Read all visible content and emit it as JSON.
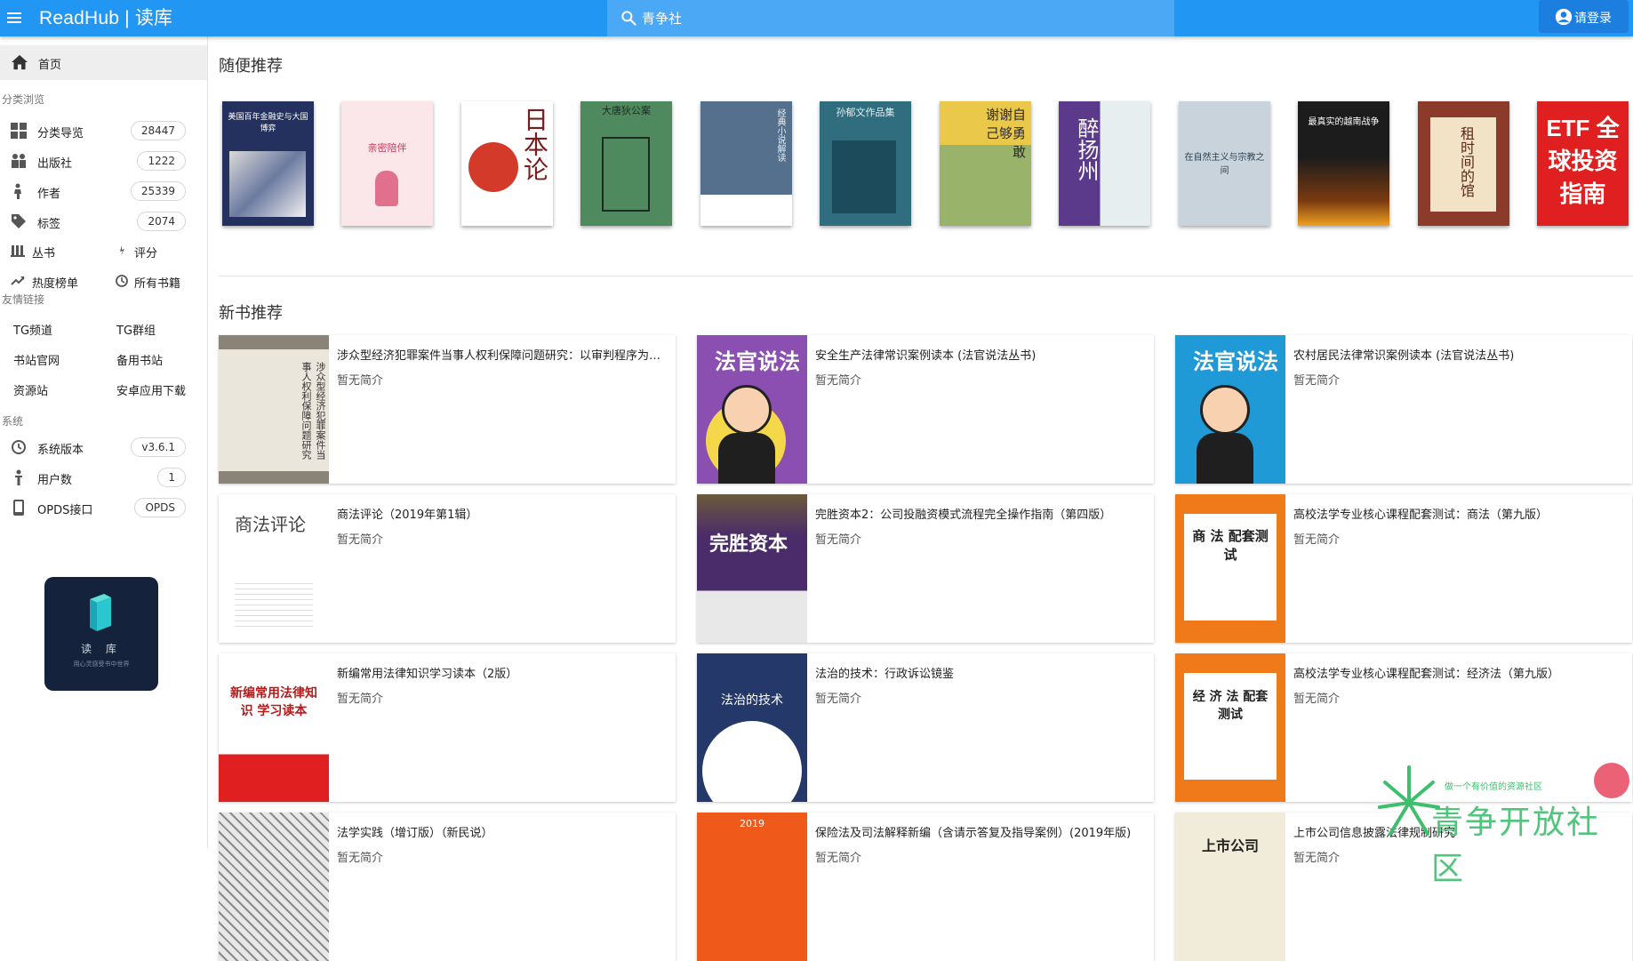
{
  "header": {
    "brand": "ReadHub | 读库",
    "search_value": "青争社",
    "login_label": "请登录"
  },
  "sidebar": {
    "home": "首页",
    "section_browse": "分类浏览",
    "browse_items": [
      {
        "label": "分类导览",
        "count": "28447",
        "icon": "grid-icon"
      },
      {
        "label": "出版社",
        "count": "1222",
        "icon": "publisher-icon"
      },
      {
        "label": "作者",
        "count": "25339",
        "icon": "person-icon"
      },
      {
        "label": "标签",
        "count": "2074",
        "icon": "tag-icon"
      }
    ],
    "series": "丛书",
    "rating": "评分",
    "hot": "热度榜单",
    "all_books": "所有书籍",
    "section_links": "友情链接",
    "links": [
      "TG频道",
      "TG群组",
      "书站官网",
      "备用书站",
      "资源站",
      "安卓应用下载"
    ],
    "section_system": "系统",
    "system_items": [
      {
        "label": "系统版本",
        "count": "v3.6.1",
        "icon": "history-icon"
      },
      {
        "label": "用户数",
        "count": "1",
        "icon": "user-icon"
      },
      {
        "label": "OPDS接口",
        "count": "OPDS",
        "icon": "phone-icon"
      }
    ],
    "app_name": "读 库",
    "app_slogan": "用心灵感受书中世界"
  },
  "main": {
    "random_title": "随便推荐",
    "new_title": "新书推荐",
    "random_covers": [
      {
        "text": "美国百年金融史与大国博弈",
        "bg": "#24305e",
        "fg": "#ffffff"
      },
      {
        "text": "亲密陪伴",
        "bg": "#fbe6ea",
        "fg": "#c73a5a"
      },
      {
        "text": "日本论",
        "bg": "#ffffff",
        "fg": "#7a1c1c"
      },
      {
        "text": "大唐狄公案",
        "bg": "#4f8a5e",
        "fg": "#1d2a22"
      },
      {
        "text": "经典小说解读",
        "bg": "#54708c",
        "fg": "#e6edf3"
      },
      {
        "text": "孙郁文作品集",
        "bg": "#2f6d7f",
        "fg": "#e0f0f4"
      },
      {
        "text": "谢谢自己够勇敢",
        "bg": "#e9c84a",
        "fg": "#2b2b2b"
      },
      {
        "text": "醉扬州",
        "bg": "#5b3a8c",
        "fg": "#ffffff"
      },
      {
        "text": "在自然主义与宗教之间",
        "bg": "#c9d3db",
        "fg": "#2d4255"
      },
      {
        "text": "最真实的越南战争",
        "bg": "#1c1c1c",
        "fg": "#ffffff"
      },
      {
        "text": "租时间的馆",
        "bg": "#8c3a2a",
        "fg": "#f2e3c6"
      },
      {
        "text": "ETF 全球投资指南",
        "bg": "#e02020",
        "fg": "#ffffff"
      }
    ],
    "cards": [
      {
        "title": "涉众型经济犯罪案件当事人权利保障问题研究：以审判程序为视角",
        "desc": "暂无简介",
        "thumb_text": "涉众型经济犯罪案件当事人权利保障问题研究",
        "thumb_bg": "#ebe6dc",
        "thumb_fg": "#333333"
      },
      {
        "title": "安全生产法律常识案例读本 (法官说法丛书)",
        "desc": "暂无简介",
        "thumb_text": "法官说法",
        "thumb_bg": "#8a4fb0",
        "thumb_fg": "#ffffff"
      },
      {
        "title": "农村居民法律常识案例读本 (法官说法丛书)",
        "desc": "暂无简介",
        "thumb_text": "法官说法",
        "thumb_bg": "#1f9ad6",
        "thumb_fg": "#ffffff"
      },
      {
        "title": "商法评论（2019年第1辑）",
        "desc": "暂无简介",
        "thumb_text": "商法评论",
        "thumb_bg": "#ffffff",
        "thumb_fg": "#444444"
      },
      {
        "title": "完胜资本2：公司投融资模式流程完全操作指南（第四版）",
        "desc": "暂无简介",
        "thumb_text": "完胜资本",
        "thumb_bg": "#4b2c6b",
        "thumb_fg": "#ffffff"
      },
      {
        "title": "高校法学专业核心课程配套测试：商法（第九版）",
        "desc": "暂无简介",
        "thumb_text": "商 法 配套测试",
        "thumb_bg": "#f07a1a",
        "thumb_fg": "#222222"
      },
      {
        "title": "新编常用法律知识学习读本（2版）",
        "desc": "暂无简介",
        "thumb_text": "新编常用法律知识 学习读本",
        "thumb_bg": "#ffffff",
        "thumb_fg": "#b21c1c"
      },
      {
        "title": "法治的技术：行政诉讼镜鉴",
        "desc": "暂无简介",
        "thumb_text": "法治的技术",
        "thumb_bg": "#24386a",
        "thumb_fg": "#ffffff"
      },
      {
        "title": "高校法学专业核心课程配套测试：经济法（第九版）",
        "desc": "暂无简介",
        "thumb_text": "经 济 法 配套测试",
        "thumb_bg": "#f07a1a",
        "thumb_fg": "#222222"
      },
      {
        "title": "法学实践（增订版）（新民说）",
        "desc": "暂无简介",
        "thumb_text": "",
        "thumb_bg": "#e8e8e8",
        "thumb_fg": "#333333"
      },
      {
        "title": "保险法及司法解释新编（含请示答复及指导案例）(2019年版)",
        "desc": "暂无简介",
        "thumb_text": "2019",
        "thumb_bg": "#ef5a1a",
        "thumb_fg": "#ffffff"
      },
      {
        "title": "上市公司信息披露法律规制研究",
        "desc": "暂无简介",
        "thumb_text": "上市公司",
        "thumb_bg": "#f1ecd9",
        "thumb_fg": "#222222"
      }
    ]
  },
  "watermark": {
    "text": "青争开放社区",
    "sub": "做一个有价值的资源社区"
  },
  "colors": {
    "primary": "#2196f3",
    "search_bg": "#4aa8f5",
    "login_bg": "#1c7fe0"
  }
}
